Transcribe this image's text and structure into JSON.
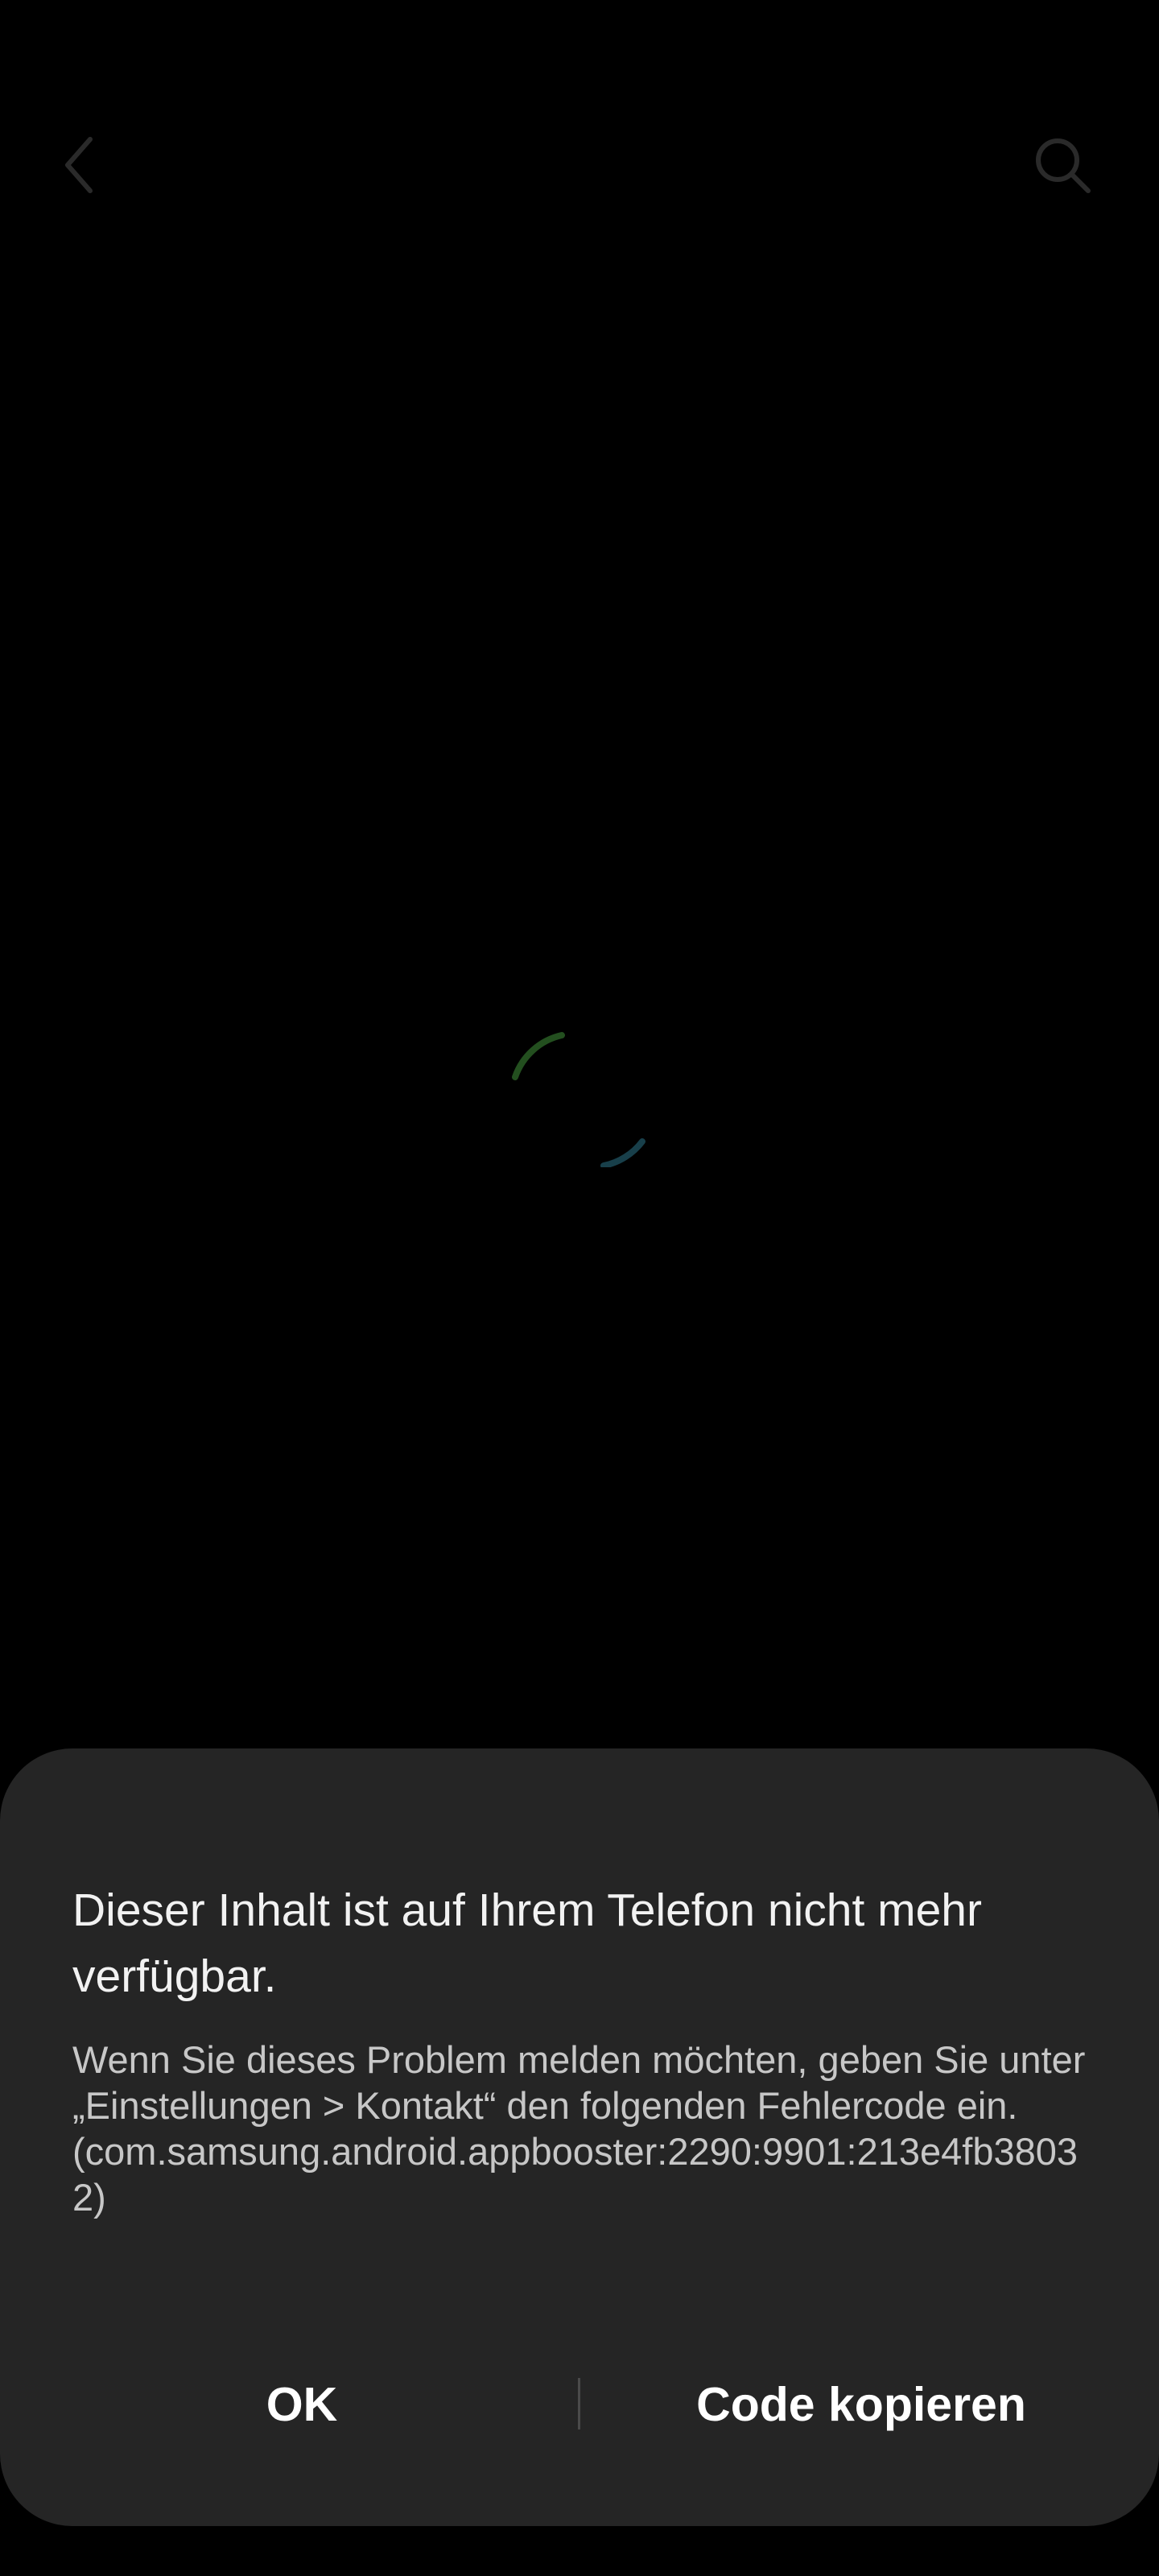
{
  "header": {
    "back_icon": "chevron-left-icon",
    "search_icon": "search-icon"
  },
  "loading": {
    "icon": "loading-spinner-icon",
    "colors": [
      "#2f6b2a",
      "#1f5e6d"
    ]
  },
  "dialog": {
    "title": "Dieser Inhalt ist auf Ihrem Telefon nicht mehr verfügbar.",
    "message": "Wenn Sie dieses Problem melden möchten, geben Sie unter „Einstellungen > Kontakt“ den folgenden Fehlercode ein.\n(com.samsung.android.appbooster:2290:9901:213e4fb38032)",
    "ok_label": "OK",
    "copy_label": "Code kopieren"
  },
  "colors": {
    "background": "#000000",
    "dialog_background": "#252525",
    "title_text": "#f2f2f2",
    "message_text": "#c7c7c7"
  }
}
